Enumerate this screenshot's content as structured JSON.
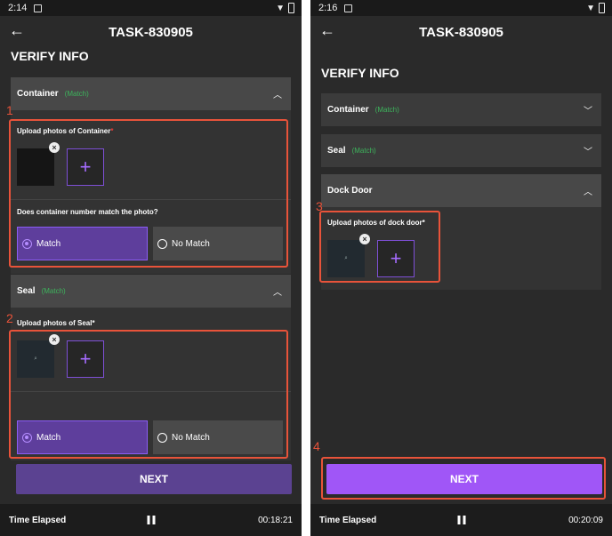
{
  "left": {
    "status": {
      "time": "2:14"
    },
    "appbar": {
      "title": "TASK-830905"
    },
    "heading": "VERIFY INFO",
    "container": {
      "label": "Container",
      "match": "(Match)",
      "upload_label": "Upload photos of Container",
      "required_mark": "*",
      "question": "Does container number  match the photo?",
      "option_match": "Match",
      "option_no_match": "No Match"
    },
    "seal": {
      "label": "Seal",
      "match": "(Match)",
      "upload_label": "Upload photos of Seal*",
      "option_match": "Match",
      "option_no_match": "No Match"
    },
    "next_label": "NEXT",
    "footer": {
      "label": "Time Elapsed",
      "time": "00:18:21"
    }
  },
  "right": {
    "status": {
      "time": "2:16"
    },
    "appbar": {
      "title": "TASK-830905"
    },
    "heading": "VERIFY INFO",
    "container": {
      "label": "Container",
      "match": "(Match)"
    },
    "seal": {
      "label": "Seal",
      "match": "(Match)"
    },
    "dock_door": {
      "label": "Dock Door",
      "upload_label": "Upload photos of dock door*"
    },
    "next_label": "NEXT",
    "footer": {
      "label": "Time Elapsed",
      "time": "00:20:09"
    }
  },
  "annotations": [
    "1",
    "2",
    "3",
    "4"
  ],
  "colors": {
    "accent": "#a056f7",
    "highlight": "#e8533a",
    "match_green": "#3db35c"
  }
}
